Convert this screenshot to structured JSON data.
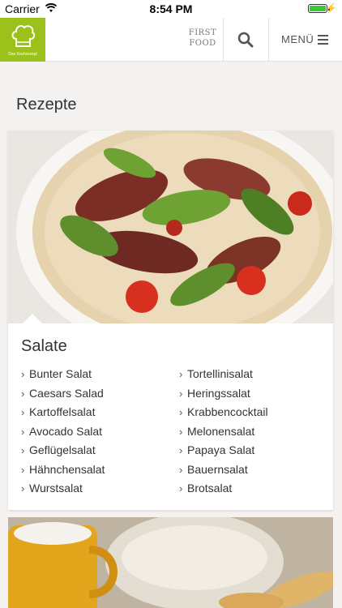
{
  "status_bar": {
    "carrier": "Carrier",
    "time": "8:54 PM"
  },
  "nav": {
    "logo_text": "Das Kochrezept",
    "brand_top": "FIRST",
    "brand_bottom": "FOOD",
    "menu_label": "MENÜ"
  },
  "page": {
    "title": "Rezepte"
  },
  "category": {
    "title": "Salate",
    "left": [
      "Bunter Salat",
      "Caesars Salad",
      "Kartoffelsalat",
      "Avocado Salat",
      "Geflügelsalat",
      "Hähnchensalat",
      "Wurstsalat"
    ],
    "right": [
      "Tortellinisalat",
      "Heringssalat",
      "Krabbencocktail",
      "Melonensalat",
      "Papaya Salat",
      "Bauernsalat",
      "Brotsalat"
    ]
  },
  "colors": {
    "accent": "#9cc11a",
    "background": "#f3f2f0"
  }
}
